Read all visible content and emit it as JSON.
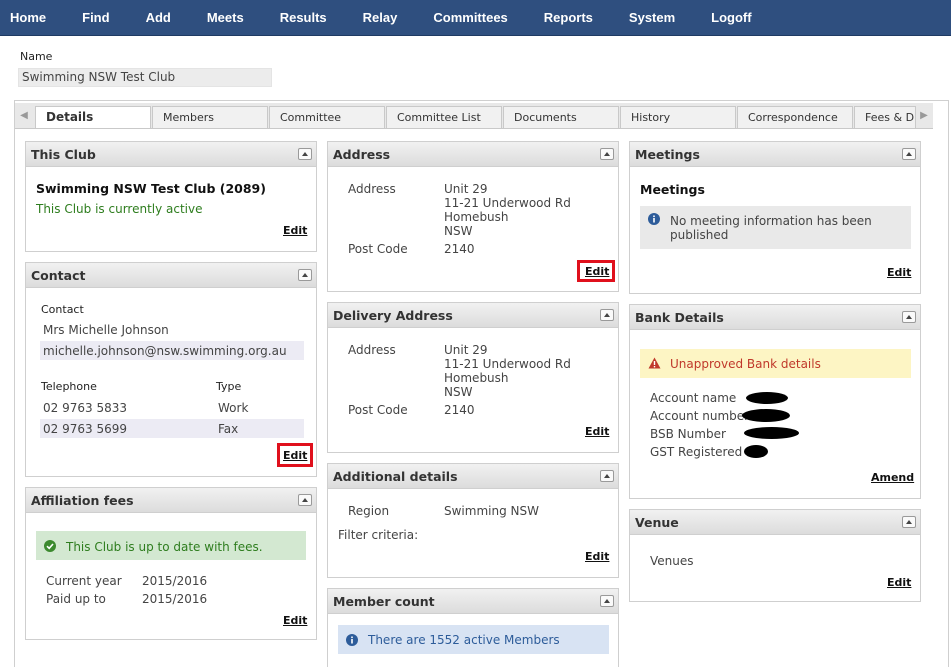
{
  "nav": [
    "Home",
    "Find",
    "Add",
    "Meets",
    "Results",
    "Relay",
    "Committees",
    "Reports",
    "System",
    "Logoff"
  ],
  "name_label": "Name",
  "name_value": "Swimming NSW Test Club",
  "tabs": [
    "Details",
    "Members",
    "Committee",
    "Committee List",
    "Documents",
    "History",
    "Correspondence",
    "Fees & Dis"
  ],
  "this_club": {
    "title": "This Club",
    "club_name": "Swimming NSW Test Club (2089)",
    "status": "This Club is currently active",
    "edit": "Edit"
  },
  "contact": {
    "title": "Contact",
    "contact_label": "Contact",
    "person": "Mrs Michelle Johnson",
    "email": "michelle.johnson@nsw.swimming.org.au",
    "tel_header": "Telephone",
    "type_header": "Type",
    "phones": [
      {
        "number": "02 9763 5833",
        "type": "Work"
      },
      {
        "number": "02 9763 5699",
        "type": "Fax"
      }
    ],
    "edit": "Edit"
  },
  "affiliation": {
    "title": "Affiliation fees",
    "message": "This Club is up to date with fees.",
    "current_year_label": "Current year",
    "current_year": "2015/2016",
    "paid_up_label": "Paid up to",
    "paid_up": "2015/2016",
    "edit": "Edit"
  },
  "address": {
    "title": "Address",
    "address_label": "Address",
    "lines": [
      "Unit 29",
      "11-21 Underwood Rd",
      "Homebush",
      "NSW"
    ],
    "postcode_label": "Post Code",
    "postcode": "2140",
    "edit": "Edit"
  },
  "delivery": {
    "title": "Delivery Address",
    "address_label": "Address",
    "lines": [
      "Unit 29",
      "11-21 Underwood Rd",
      "Homebush",
      "NSW"
    ],
    "postcode_label": "Post Code",
    "postcode": "2140",
    "edit": "Edit"
  },
  "additional": {
    "title": "Additional details",
    "region_label": "Region",
    "region": "Swimming NSW",
    "filter_label": "Filter criteria:",
    "edit": "Edit"
  },
  "member_count": {
    "title": "Member count",
    "message": "There are 1552 active Members"
  },
  "meetings": {
    "title": "Meetings",
    "subtitle": "Meetings",
    "message_line1": "No meeting information has been",
    "message_line2": "published",
    "edit": "Edit"
  },
  "bank": {
    "title": "Bank Details",
    "warning": "Unapproved Bank details",
    "account_name": "Account name",
    "account_number": "Account number",
    "bsb": "BSB Number",
    "gst": "GST Registered",
    "amend": "Amend"
  },
  "venue": {
    "title": "Venue",
    "venues_label": "Venues",
    "edit": "Edit"
  },
  "colors": {
    "nav_bg": "#2f4f7f",
    "active_text": "#2e7d1e",
    "warning_text": "#c0392b",
    "highlight_border": "#e0101c"
  }
}
